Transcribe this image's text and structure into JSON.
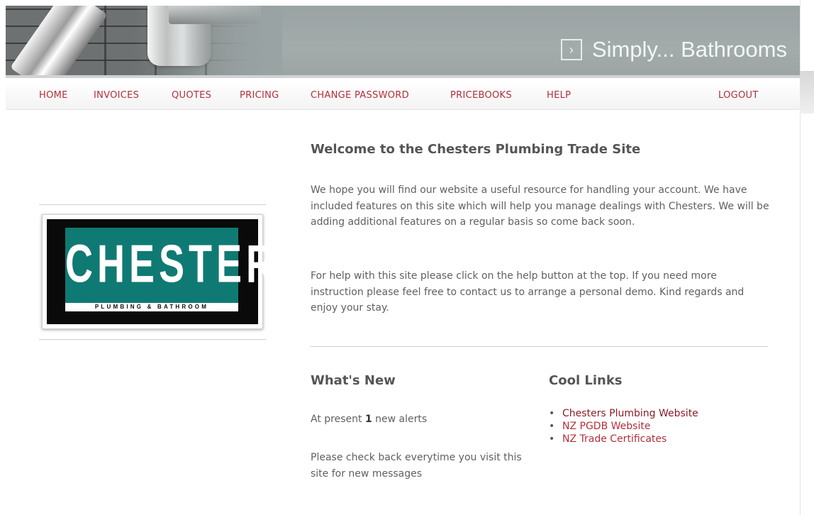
{
  "header": {
    "brand_arrow": "›",
    "brand_text": "Simply... Bathrooms"
  },
  "nav": {
    "home": "HOME",
    "invoices": "INVOICES",
    "quotes": "QUOTES",
    "pricing": "PRICING",
    "change_password": "CHANGE PASSWORD",
    "pricebooks": "PRICEBOOKS",
    "help": "HELP",
    "logout": "LOGOUT"
  },
  "logo": {
    "word": "CHESTERS",
    "sub": "PLUMBING & BATHROOM"
  },
  "main": {
    "title": "Welcome to the Chesters Plumbing Trade Site",
    "para1": "We hope you will find our website a useful resource for handling your account. We have included features on this site which will help you manage dealings with Chesters. We will be adding additional features on a regular basis so come back soon.",
    "para2": " For help with this site please click on the help button at the top. If you need more instruction please feel free to contact us to arrange a personal demo. Kind regards and enjoy your stay."
  },
  "whats_new": {
    "heading": "What's New",
    "alerts_prefix": "At present ",
    "alerts_count": "1",
    "alerts_suffix": " new alerts",
    "note": "Please check back everytime you visit this site for new messages"
  },
  "cool_links": {
    "heading": "Cool Links",
    "items": [
      {
        "label": "Chesters Plumbing Website"
      },
      {
        "label": "NZ PGDB Website"
      },
      {
        "label": "NZ Trade Certificates"
      }
    ]
  },
  "colors": {
    "link": "#b32f3a",
    "banner": "#9aa3a3",
    "logo_teal": "#0f7a73"
  }
}
